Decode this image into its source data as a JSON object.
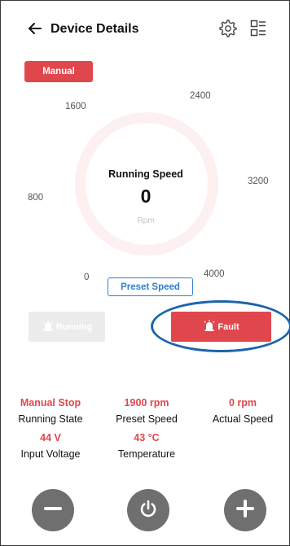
{
  "header": {
    "title": "Device Details",
    "back_icon": "arrow-left-icon",
    "settings_icon": "gear-icon",
    "menu_icon": "list-grid-icon"
  },
  "mode": {
    "label": "Manual"
  },
  "gauge": {
    "title": "Running Speed",
    "value": "0",
    "unit": "Rpm",
    "ticks": [
      "0",
      "800",
      "1600",
      "2400",
      "3200",
      "4000"
    ]
  },
  "preset_button": {
    "label": "Preset Speed"
  },
  "status_buttons": {
    "running": {
      "label": "Running",
      "icon": "alarm-light-icon"
    },
    "fault": {
      "label": "Fault",
      "icon": "alarm-light-icon"
    }
  },
  "metrics": [
    {
      "value": "Manual Stop",
      "label": "Running State"
    },
    {
      "value": "1900 rpm",
      "label": "Preset Speed"
    },
    {
      "value": "0 rpm",
      "label": "Actual Speed"
    },
    {
      "value": "44 V",
      "label": "Input Voltage"
    },
    {
      "value": "43 °C",
      "label": "Temperature"
    }
  ],
  "controls": {
    "decrease_icon": "minus-icon",
    "power_icon": "power-icon",
    "increase_icon": "plus-icon"
  },
  "colors": {
    "accent_red": "#e0474c",
    "link_blue": "#2f7fd6",
    "highlight_blue": "#1c63ad",
    "control_gray": "#6f6f6f"
  }
}
